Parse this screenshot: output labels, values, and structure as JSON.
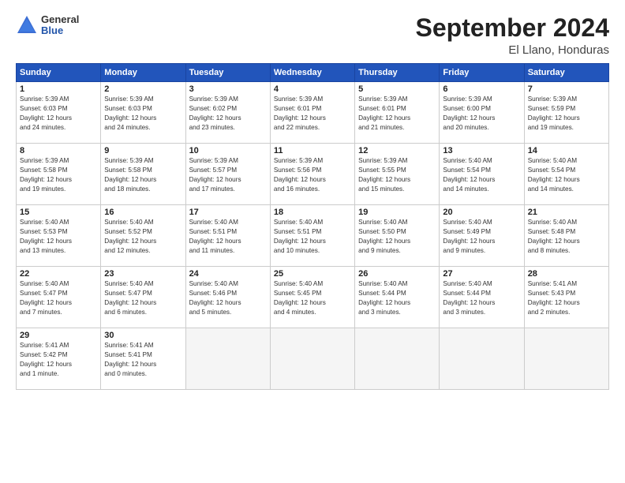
{
  "logo": {
    "general": "General",
    "blue": "Blue"
  },
  "title": "September 2024",
  "location": "El Llano, Honduras",
  "days_of_week": [
    "Sunday",
    "Monday",
    "Tuesday",
    "Wednesday",
    "Thursday",
    "Friday",
    "Saturday"
  ],
  "weeks": [
    [
      {
        "day": 1,
        "info": "Sunrise: 5:39 AM\nSunset: 6:03 PM\nDaylight: 12 hours\nand 24 minutes."
      },
      {
        "day": 2,
        "info": "Sunrise: 5:39 AM\nSunset: 6:03 PM\nDaylight: 12 hours\nand 24 minutes."
      },
      {
        "day": 3,
        "info": "Sunrise: 5:39 AM\nSunset: 6:02 PM\nDaylight: 12 hours\nand 23 minutes."
      },
      {
        "day": 4,
        "info": "Sunrise: 5:39 AM\nSunset: 6:01 PM\nDaylight: 12 hours\nand 22 minutes."
      },
      {
        "day": 5,
        "info": "Sunrise: 5:39 AM\nSunset: 6:01 PM\nDaylight: 12 hours\nand 21 minutes."
      },
      {
        "day": 6,
        "info": "Sunrise: 5:39 AM\nSunset: 6:00 PM\nDaylight: 12 hours\nand 20 minutes."
      },
      {
        "day": 7,
        "info": "Sunrise: 5:39 AM\nSunset: 5:59 PM\nDaylight: 12 hours\nand 19 minutes."
      }
    ],
    [
      {
        "day": 8,
        "info": "Sunrise: 5:39 AM\nSunset: 5:58 PM\nDaylight: 12 hours\nand 19 minutes."
      },
      {
        "day": 9,
        "info": "Sunrise: 5:39 AM\nSunset: 5:58 PM\nDaylight: 12 hours\nand 18 minutes."
      },
      {
        "day": 10,
        "info": "Sunrise: 5:39 AM\nSunset: 5:57 PM\nDaylight: 12 hours\nand 17 minutes."
      },
      {
        "day": 11,
        "info": "Sunrise: 5:39 AM\nSunset: 5:56 PM\nDaylight: 12 hours\nand 16 minutes."
      },
      {
        "day": 12,
        "info": "Sunrise: 5:39 AM\nSunset: 5:55 PM\nDaylight: 12 hours\nand 15 minutes."
      },
      {
        "day": 13,
        "info": "Sunrise: 5:40 AM\nSunset: 5:54 PM\nDaylight: 12 hours\nand 14 minutes."
      },
      {
        "day": 14,
        "info": "Sunrise: 5:40 AM\nSunset: 5:54 PM\nDaylight: 12 hours\nand 14 minutes."
      }
    ],
    [
      {
        "day": 15,
        "info": "Sunrise: 5:40 AM\nSunset: 5:53 PM\nDaylight: 12 hours\nand 13 minutes."
      },
      {
        "day": 16,
        "info": "Sunrise: 5:40 AM\nSunset: 5:52 PM\nDaylight: 12 hours\nand 12 minutes."
      },
      {
        "day": 17,
        "info": "Sunrise: 5:40 AM\nSunset: 5:51 PM\nDaylight: 12 hours\nand 11 minutes."
      },
      {
        "day": 18,
        "info": "Sunrise: 5:40 AM\nSunset: 5:51 PM\nDaylight: 12 hours\nand 10 minutes."
      },
      {
        "day": 19,
        "info": "Sunrise: 5:40 AM\nSunset: 5:50 PM\nDaylight: 12 hours\nand 9 minutes."
      },
      {
        "day": 20,
        "info": "Sunrise: 5:40 AM\nSunset: 5:49 PM\nDaylight: 12 hours\nand 9 minutes."
      },
      {
        "day": 21,
        "info": "Sunrise: 5:40 AM\nSunset: 5:48 PM\nDaylight: 12 hours\nand 8 minutes."
      }
    ],
    [
      {
        "day": 22,
        "info": "Sunrise: 5:40 AM\nSunset: 5:47 PM\nDaylight: 12 hours\nand 7 minutes."
      },
      {
        "day": 23,
        "info": "Sunrise: 5:40 AM\nSunset: 5:47 PM\nDaylight: 12 hours\nand 6 minutes."
      },
      {
        "day": 24,
        "info": "Sunrise: 5:40 AM\nSunset: 5:46 PM\nDaylight: 12 hours\nand 5 minutes."
      },
      {
        "day": 25,
        "info": "Sunrise: 5:40 AM\nSunset: 5:45 PM\nDaylight: 12 hours\nand 4 minutes."
      },
      {
        "day": 26,
        "info": "Sunrise: 5:40 AM\nSunset: 5:44 PM\nDaylight: 12 hours\nand 3 minutes."
      },
      {
        "day": 27,
        "info": "Sunrise: 5:40 AM\nSunset: 5:44 PM\nDaylight: 12 hours\nand 3 minutes."
      },
      {
        "day": 28,
        "info": "Sunrise: 5:41 AM\nSunset: 5:43 PM\nDaylight: 12 hours\nand 2 minutes."
      }
    ],
    [
      {
        "day": 29,
        "info": "Sunrise: 5:41 AM\nSunset: 5:42 PM\nDaylight: 12 hours\nand 1 minute."
      },
      {
        "day": 30,
        "info": "Sunrise: 5:41 AM\nSunset: 5:41 PM\nDaylight: 12 hours\nand 0 minutes."
      },
      null,
      null,
      null,
      null,
      null
    ]
  ]
}
